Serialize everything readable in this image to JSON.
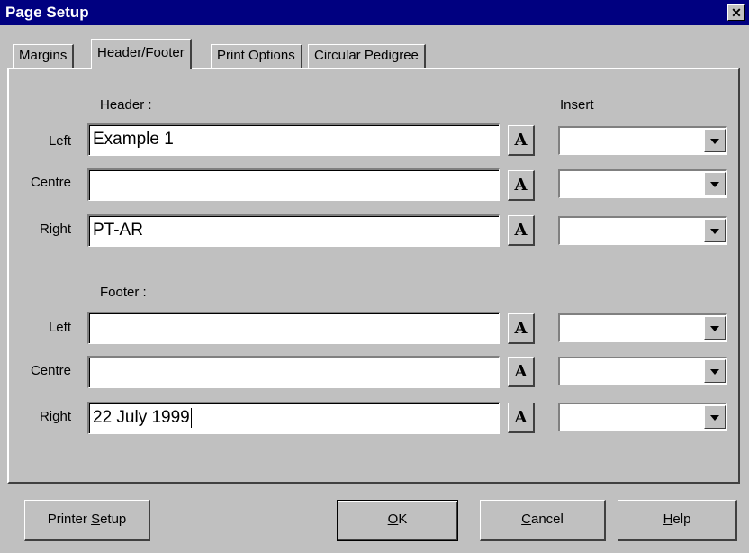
{
  "window": {
    "title": "Page Setup"
  },
  "tabs": [
    {
      "label": "Margins"
    },
    {
      "label": "Header/Footer"
    },
    {
      "label": "Print Options"
    },
    {
      "label": "Circular Pedigree"
    }
  ],
  "header": {
    "label": "Header :",
    "insert_label": "Insert",
    "rows": [
      {
        "label": "Left",
        "value": "Example 1",
        "insert": ""
      },
      {
        "label": "Centre",
        "value": "",
        "insert": ""
      },
      {
        "label": "Right",
        "value": "PT-AR",
        "insert": ""
      }
    ]
  },
  "footer": {
    "label": "Footer :",
    "rows": [
      {
        "label": "Left",
        "value": "",
        "insert": ""
      },
      {
        "label": "Centre",
        "value": "",
        "insert": ""
      },
      {
        "label": "Right",
        "value": "22 July 1999",
        "insert": ""
      }
    ]
  },
  "font_button_label": "A",
  "buttons": {
    "printer_setup_pre": "Printer ",
    "printer_setup_key": "S",
    "printer_setup_post": "etup",
    "ok_key": "O",
    "ok_post": "K",
    "cancel_key": "C",
    "cancel_post": "ancel",
    "help_key": "H",
    "help_post": "elp"
  }
}
